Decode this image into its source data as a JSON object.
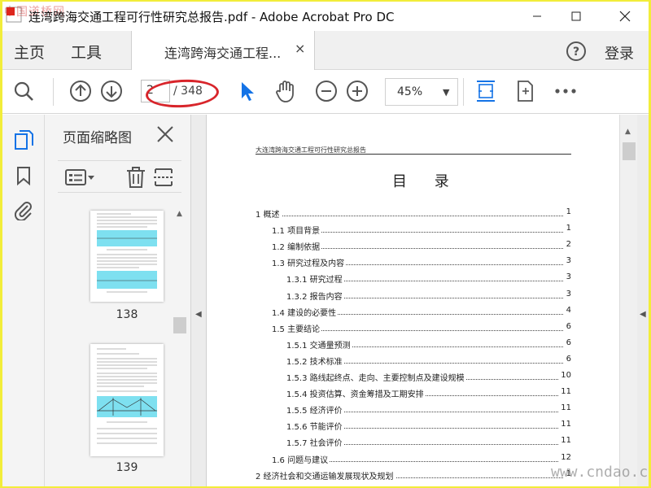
{
  "window": {
    "title": "连湾跨海交通工程可行性研究总报告.pdf - Adobe Acrobat Pro DC",
    "watermark_top_left": "中国道桥网",
    "watermark_bottom_right": "www.cndao.com"
  },
  "menu": {
    "home": "主页",
    "tools": "工具",
    "doc_tab": "连湾跨海交通工程...",
    "doc_tab_close": "×",
    "login": "登录"
  },
  "toolbar": {
    "page_current": "2",
    "page_total": "/ 348",
    "zoom": "45%"
  },
  "thumb_panel": {
    "title": "页面缩略图",
    "thumbs": [
      {
        "page": "138"
      },
      {
        "page": "139"
      }
    ]
  },
  "document": {
    "header": "大连湾跨海交通工程可行性研究总报告",
    "title": "目 录",
    "toc": [
      {
        "text": "1  概述",
        "page": "1",
        "level": 0
      },
      {
        "text": "1.1  项目背景",
        "page": "1",
        "level": 1
      },
      {
        "text": "1.2  编制依据",
        "page": "2",
        "level": 1
      },
      {
        "text": "1.3  研究过程及内容",
        "page": "3",
        "level": 1
      },
      {
        "text": "1.3.1  研究过程",
        "page": "3",
        "level": 2
      },
      {
        "text": "1.3.2  报告内容",
        "page": "3",
        "level": 2
      },
      {
        "text": "1.4  建设的必要性",
        "page": "4",
        "level": 1
      },
      {
        "text": "1.5  主要结论",
        "page": "6",
        "level": 1
      },
      {
        "text": "1.5.1  交通量预测",
        "page": "6",
        "level": 2
      },
      {
        "text": "1.5.2  技术标准",
        "page": "6",
        "level": 2
      },
      {
        "text": "1.5.3  路线起终点、走向、主要控制点及建设规模",
        "page": "10",
        "level": 2
      },
      {
        "text": "1.5.4  投资估算、资金筹措及工期安排",
        "page": "11",
        "level": 2
      },
      {
        "text": "1.5.5  经济评价",
        "page": "11",
        "level": 2
      },
      {
        "text": "1.5.6  节能评价",
        "page": "11",
        "level": 2
      },
      {
        "text": "1.5.7  社会评价",
        "page": "11",
        "level": 2
      },
      {
        "text": "1.6  问题与建议",
        "page": "12",
        "level": 1
      },
      {
        "text": "2  经济社会和交通运输发展现状及规划",
        "page": "1",
        "level": 0
      }
    ]
  },
  "colors": {
    "accent_blue": "#1473e6",
    "highlight_red": "#d8252b",
    "frame_yellow": "#f2ed3a"
  }
}
